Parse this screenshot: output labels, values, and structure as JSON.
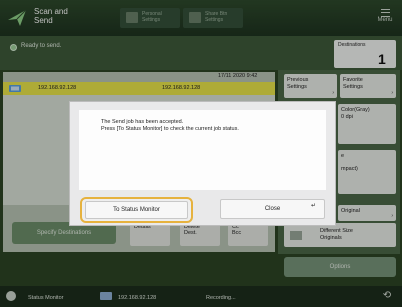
{
  "app": {
    "title": "Scan and\nSend",
    "icon": "scan-send-icon"
  },
  "header": {
    "buttons": [
      {
        "label": "Personal\nSettings",
        "icon": "personal-settings-icon"
      },
      {
        "label": "Share Btn\nSettings",
        "icon": "shared-settings-icon"
      }
    ],
    "menu_label": "Menu"
  },
  "status": {
    "text": "Ready to send."
  },
  "destinations": {
    "label": "Destinations",
    "count": "1"
  },
  "list": {
    "datetime": "17/11 2020 9:42",
    "row": {
      "ip": "192.168.92.128",
      "ip_secondary": "192.168.92.128"
    }
  },
  "actions": {
    "specify": "Specify Destinations",
    "details": "Details",
    "delete": "Delete\nDest.",
    "cc_bcc": "Cc\nBcc"
  },
  "side": {
    "previous": "Previous\nSettings",
    "favorite": "Favorite\nSettings",
    "color": "Color(Gray)",
    "resolution": "0 dpi",
    "format": "e",
    "compact": "mpact)",
    "original": "Original",
    "different_size": "Different Size\nOriginals",
    "options": "Options"
  },
  "bottom": {
    "status_monitor": "Status Monitor",
    "ip": "192.168.92.128",
    "recording": "Recording..."
  },
  "modal": {
    "message": "The Send job has been accepted.\nPress [To Status Monitor] to check the current job status.",
    "to_status_monitor": "To Status Monitor",
    "close": "Close"
  },
  "colors": {
    "header_bg": "#2e4a2c",
    "highlight_row": "#e8e44a",
    "focus_border": "#e6b23e"
  }
}
